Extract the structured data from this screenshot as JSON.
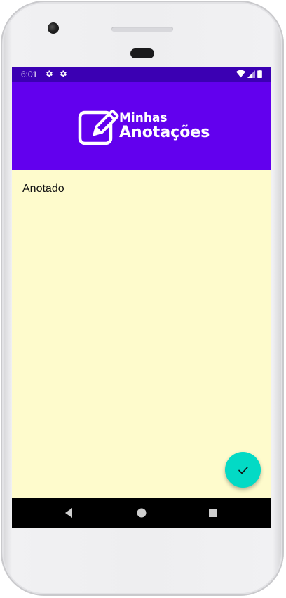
{
  "status_bar": {
    "time": "6:01",
    "icons": [
      "settings-icon",
      "settings-icon",
      "wifi-icon",
      "signal-icon",
      "battery-icon"
    ]
  },
  "app_bar": {
    "title_line1": "Minhas",
    "title_line2": "Anotações",
    "logo_icon": "edit-note-icon",
    "color": "#6200ee"
  },
  "note": {
    "content": "Anotado",
    "background": "#fefbcc"
  },
  "fab": {
    "icon": "check-icon",
    "color": "#03dac5"
  },
  "nav_bar": {
    "buttons": [
      "back-icon",
      "home-icon",
      "recents-icon"
    ]
  }
}
